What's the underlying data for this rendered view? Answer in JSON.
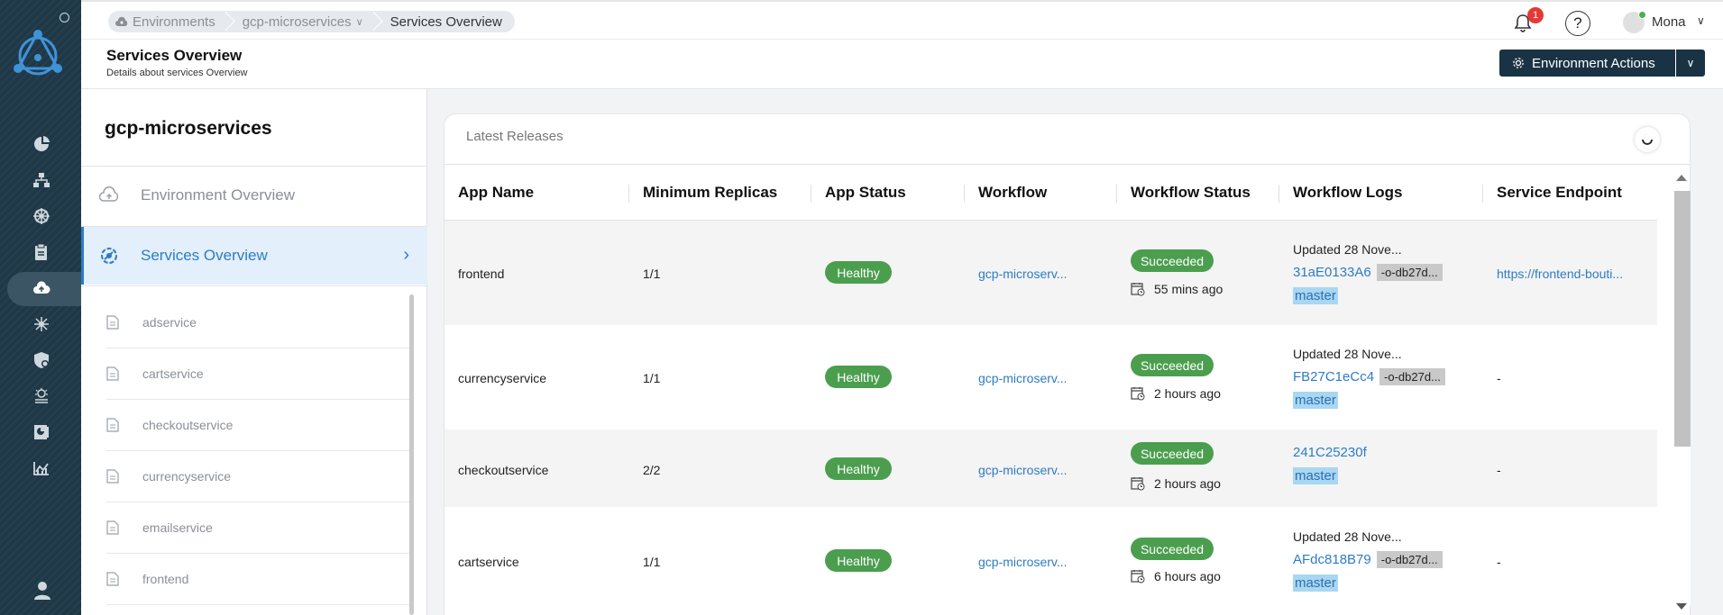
{
  "colors": {
    "rail": "#1f3847",
    "accent": "#2d7cc4",
    "healthy": "#4b9e4e",
    "button": "#1a3344"
  },
  "rail": {
    "icons": [
      "pie-chart-icon",
      "hierarchy-icon",
      "helm-wheel-icon",
      "clipboard-icon",
      "cloud-upload-icon",
      "cluster-icon",
      "shield-icon",
      "helm-icon",
      "chart-book-icon",
      "bar-chart-icon",
      "user-icon"
    ]
  },
  "breadcrumb": {
    "items": [
      "Environments",
      "gcp-microservices",
      "Services Overview"
    ]
  },
  "topbar": {
    "notification_count": "1",
    "help": "?",
    "user_name": "Mona"
  },
  "header": {
    "title": "Services Overview",
    "subtitle": "Details about services Overview",
    "env_actions": "Environment Actions"
  },
  "left_panel": {
    "title": "gcp-microservices",
    "nav": [
      {
        "label": "Environment Overview"
      },
      {
        "label": "Services Overview"
      }
    ],
    "services": [
      "adservice",
      "cartservice",
      "checkoutservice",
      "currencyservice",
      "emailservice",
      "frontend"
    ]
  },
  "releases": {
    "title": "Latest Releases",
    "columns": [
      "App Name",
      "Minimum Replicas",
      "App Status",
      "Workflow",
      "Workflow Status",
      "Workflow Logs",
      "Service Endpoint"
    ],
    "rows": [
      {
        "app": "frontend",
        "replicas": "1/1",
        "status": "Healthy",
        "workflow": "gcp-microserv...",
        "wf_status": "Succeeded",
        "time": "55 mins ago",
        "updated": "Updated 28 Nove...",
        "commit": "31aE0133A6",
        "hash": "-o-db27d...",
        "branch": "master",
        "endpoint": "https://frontend-bouti..."
      },
      {
        "app": "currencyservice",
        "replicas": "1/1",
        "status": "Healthy",
        "workflow": "gcp-microserv...",
        "wf_status": "Succeeded",
        "time": "2 hours ago",
        "updated": "Updated 28 Nove...",
        "commit": "FB27C1eCc4",
        "hash": "-o-db27d...",
        "branch": "master",
        "endpoint": "-"
      },
      {
        "app": "checkoutservice",
        "replicas": "2/2",
        "status": "Healthy",
        "workflow": "gcp-microserv...",
        "wf_status": "Succeeded",
        "time": "2 hours ago",
        "updated": "",
        "commit": "241C25230f",
        "hash": "",
        "branch": "master",
        "endpoint": "-"
      },
      {
        "app": "cartservice",
        "replicas": "1/1",
        "status": "Healthy",
        "workflow": "gcp-microserv...",
        "wf_status": "Succeeded",
        "time": "6 hours ago",
        "updated": "Updated 28 Nove...",
        "commit": "AFdc818B79",
        "hash": "-o-db27d...",
        "branch": "master",
        "endpoint": "-"
      }
    ]
  }
}
